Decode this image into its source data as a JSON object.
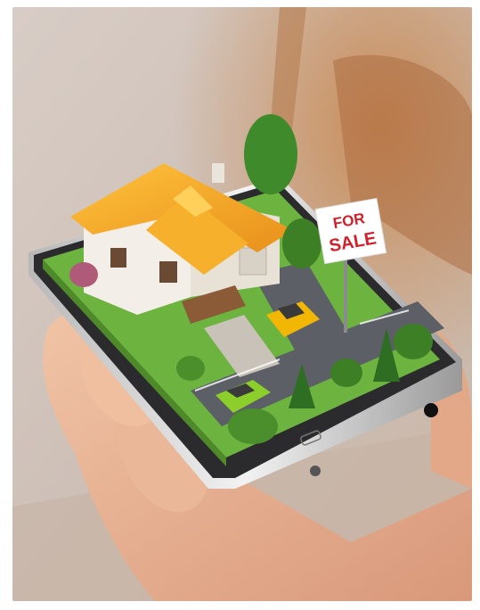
{
  "sign": {
    "line1": "FOR",
    "line2": "SALE"
  },
  "colors": {
    "roof": "#f5a623",
    "sign_text": "#d21f2a",
    "lawn": "#6db33f",
    "car_yellow": "#f2b705",
    "car_green": "#8ccf2a",
    "phone_body": "#2b2b2e",
    "skin": "#e9b596"
  }
}
